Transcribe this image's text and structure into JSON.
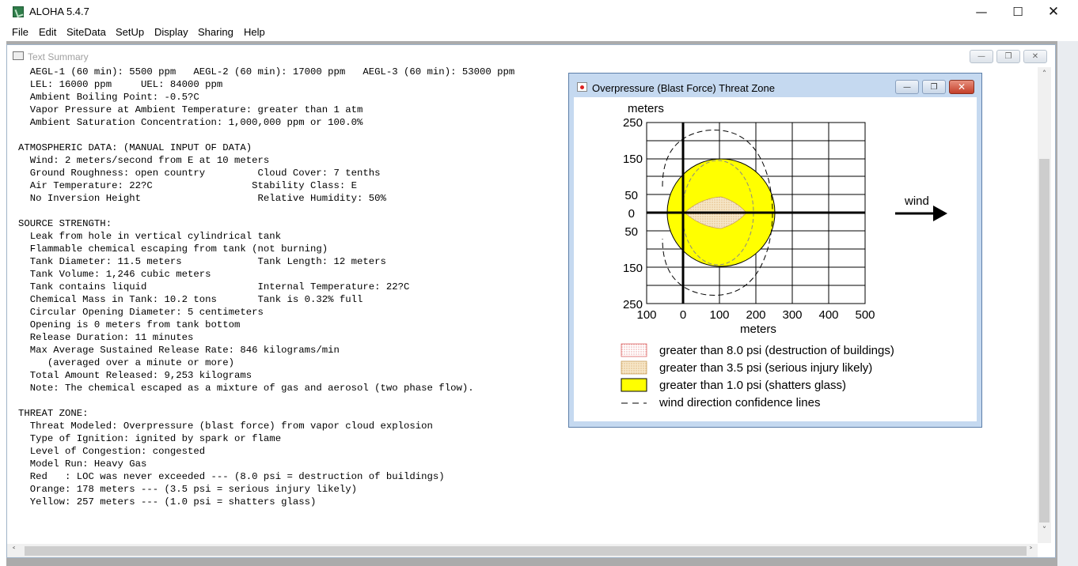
{
  "app": {
    "title": "ALOHA 5.4.7",
    "menu": [
      "File",
      "Edit",
      "SiteData",
      "SetUp",
      "Display",
      "Sharing",
      "Help"
    ]
  },
  "text_summary": {
    "window_title": "Text Summary",
    "lines": [
      "  AEGL-1 (60 min): 5500 ppm   AEGL-2 (60 min): 17000 ppm   AEGL-3 (60 min): 53000 ppm",
      "  LEL: 16000 ppm     UEL: 84000 ppm",
      "  Ambient Boiling Point: -0.5?C",
      "  Vapor Pressure at Ambient Temperature: greater than 1 atm",
      "  Ambient Saturation Concentration: 1,000,000 ppm or 100.0%",
      "",
      "ATMOSPHERIC DATA: (MANUAL INPUT OF DATA)",
      "  Wind: 2 meters/second from E at 10 meters",
      "  Ground Roughness: open country         Cloud Cover: 7 tenths",
      "  Air Temperature: 22?C                 Stability Class: E",
      "  No Inversion Height                    Relative Humidity: 50%",
      "",
      "SOURCE STRENGTH:",
      "  Leak from hole in vertical cylindrical tank",
      "  Flammable chemical escaping from tank (not burning)",
      "  Tank Diameter: 11.5 meters             Tank Length: 12 meters",
      "  Tank Volume: 1,246 cubic meters",
      "  Tank contains liquid                   Internal Temperature: 22?C",
      "  Chemical Mass in Tank: 10.2 tons       Tank is 0.32% full",
      "  Circular Opening Diameter: 5 centimeters",
      "  Opening is 0 meters from tank bottom",
      "  Release Duration: 11 minutes",
      "  Max Average Sustained Release Rate: 846 kilograms/min",
      "     (averaged over a minute or more)",
      "  Total Amount Released: 9,253 kilograms",
      "  Note: The chemical escaped as a mixture of gas and aerosol (two phase flow).",
      "",
      "THREAT ZONE:",
      "  Threat Modeled: Overpressure (blast force) from vapor cloud explosion",
      "  Type of Ignition: ignited by spark or flame",
      "  Level of Congestion: congested",
      "  Model Run: Heavy Gas",
      "  Red   : LOC was never exceeded --- (8.0 psi = destruction of buildings)",
      "  Orange: 178 meters --- (3.5 psi = serious injury likely)",
      "  Yellow: 257 meters --- (1.0 psi = shatters glass)"
    ]
  },
  "threat_zone": {
    "window_title": "Overpressure (Blast Force) Threat Zone",
    "y_unit": "meters",
    "x_unit": "meters",
    "y_ticks": [
      "250",
      "150",
      "50",
      "0",
      "50",
      "150",
      "250"
    ],
    "x_ticks": [
      "100",
      "0",
      "100",
      "200",
      "300",
      "400",
      "500"
    ],
    "wind_label": "wind",
    "legend": [
      {
        "label": "greater than 8.0 psi (destruction of buildings)",
        "color": "#ffffff"
      },
      {
        "label": "greater than 3.5 psi (serious injury likely)",
        "color": "#f3e1c2"
      },
      {
        "label": "greater than 1.0 psi (shatters glass)",
        "color": "#ffff00"
      },
      {
        "label": "wind direction confidence lines",
        "color": "#000000"
      }
    ],
    "zones": {
      "orange_m": 178,
      "yellow_m": 257
    }
  }
}
